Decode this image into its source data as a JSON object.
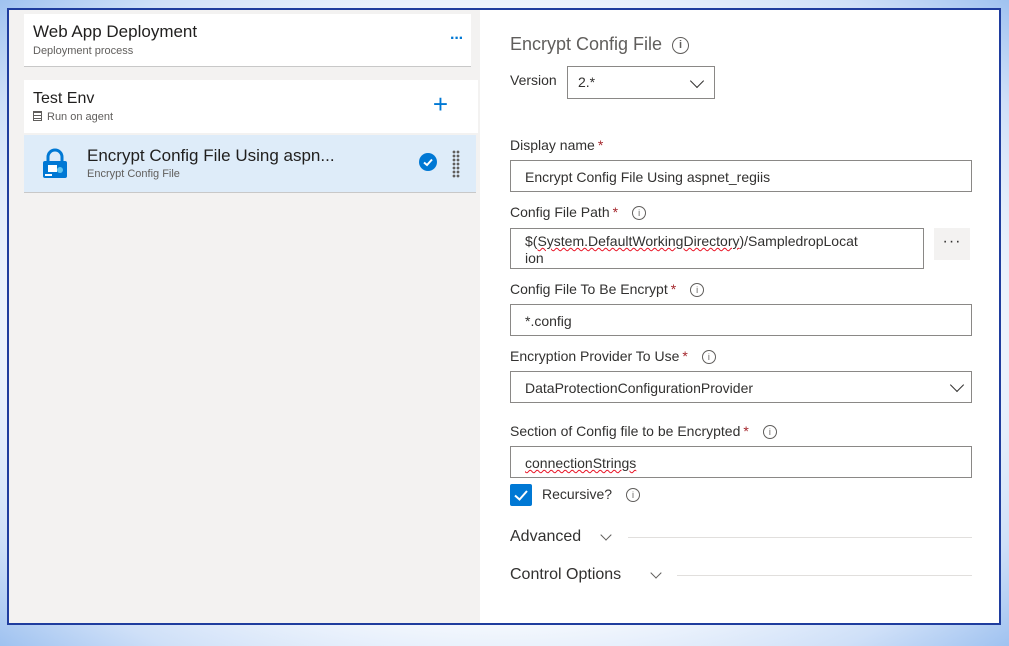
{
  "pipeline": {
    "title": "Web App Deployment",
    "subtitle": "Deployment process",
    "more_label": "···"
  },
  "environment": {
    "title": "Test Env",
    "subtitle": "Run on agent",
    "add_label": "+"
  },
  "task": {
    "title": "Encrypt Config File Using aspn...",
    "subtitle": "Encrypt Config File"
  },
  "panel": {
    "title": "Encrypt Config File",
    "version_label": "Version",
    "version_value": "2.*",
    "display_name_label": "Display name",
    "display_name_value": "Encrypt Config File Using aspnet_regiis",
    "config_path_label": "Config File Path",
    "config_path_prefix": "$(",
    "config_path_var": "System.DefaultWorkingDirectory",
    "config_path_suffix": ")/SampledropLocat",
    "config_path_wrap": "ion",
    "browse_label": "···",
    "config_encrypt_label": "Config File To Be Encrypt",
    "config_encrypt_value": "*.config",
    "provider_label": "Encryption Provider To Use",
    "provider_value": "DataProtectionConfigurationProvider",
    "section_label": "Section of Config file to be Encrypted",
    "section_value": "connectionStrings",
    "recursive_label": "Recursive?",
    "recursive_checked": true,
    "required_mark": "*",
    "info_glyph": "i",
    "advanced_label": "Advanced",
    "control_options_label": "Control Options"
  },
  "colors": {
    "accent": "#0078d4",
    "required": "#a4262c",
    "selected_row": "#deecf9",
    "frame_border": "#1f3d9e"
  },
  "icons": [
    "more-icon",
    "add-icon",
    "lock-task-icon",
    "check-circle-icon",
    "drag-handle-icon",
    "info-icon",
    "chevron-down-icon",
    "checkbox-check-icon",
    "agent-icon"
  ]
}
